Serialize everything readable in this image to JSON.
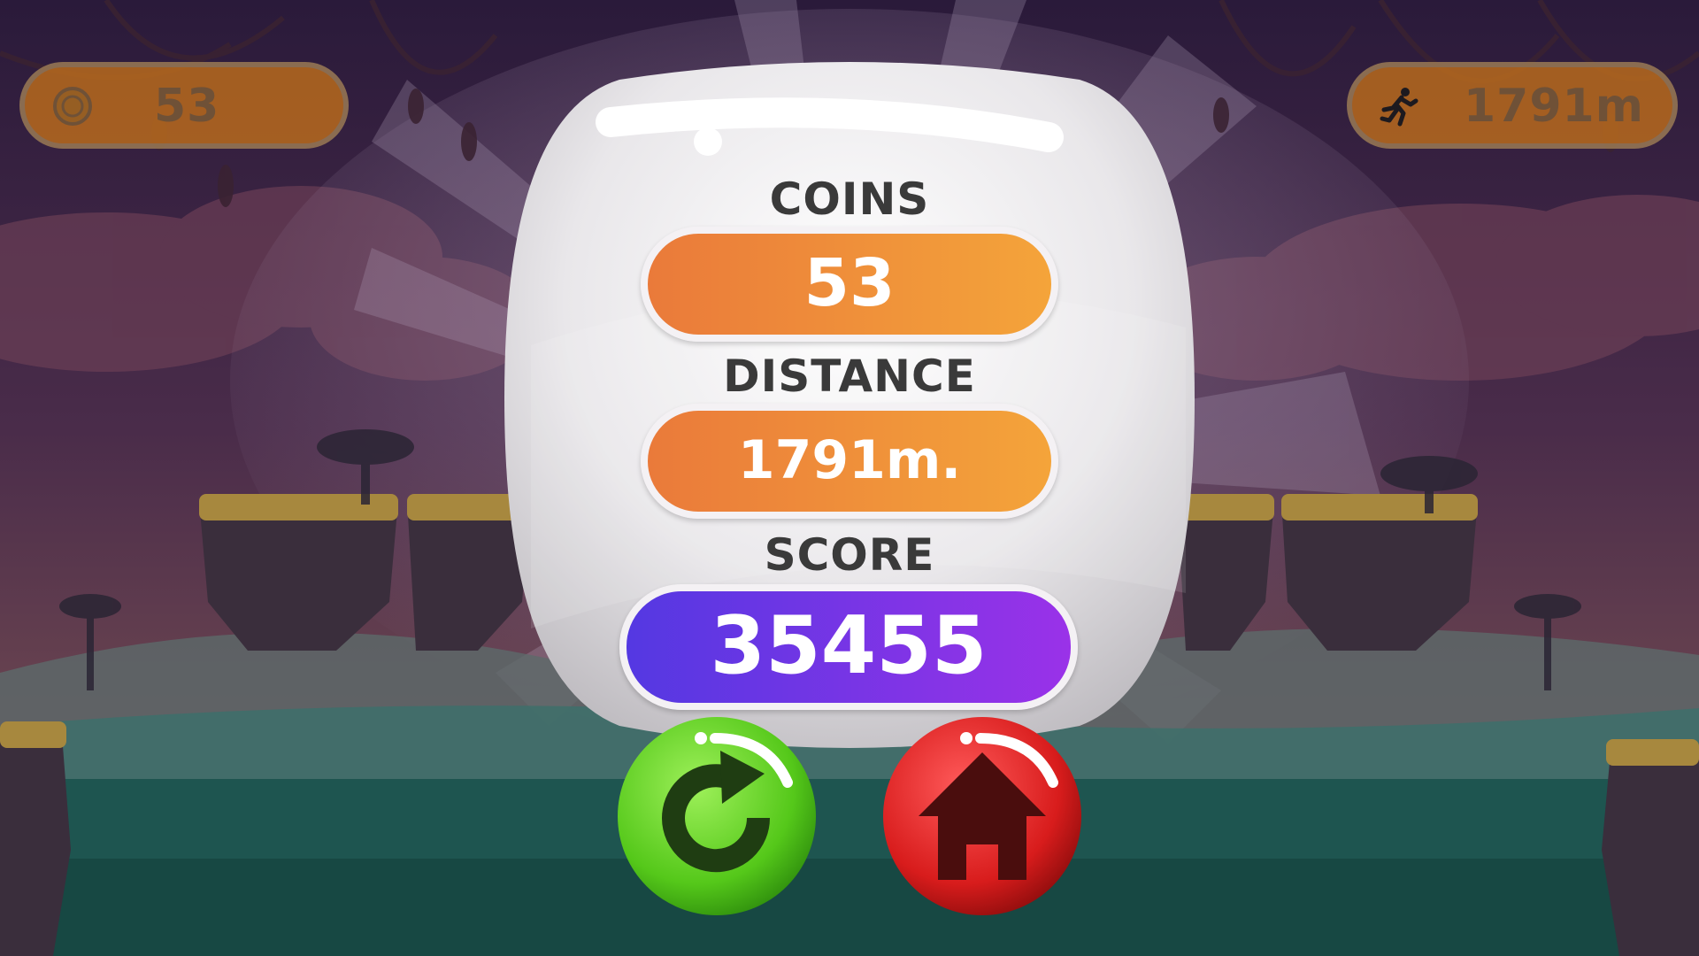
{
  "hud": {
    "coins_value": "53",
    "coin_icon": "coin-icon",
    "distance_value": "1791m",
    "distance_icon": "running-man-icon"
  },
  "results": {
    "coins_label": "COINS",
    "coins_value": "53",
    "distance_label": "DISTANCE",
    "distance_value": "1791m.",
    "score_label": "SCORE",
    "score_value": "35455"
  },
  "buttons": {
    "replay_icon": "replay-icon",
    "home_icon": "home-icon"
  },
  "colors": {
    "coins_pill": "#ef8b3a",
    "distance_pill": "#ef8b3a",
    "score_pill": "#6a35e5",
    "replay_button": "#5ccc1e",
    "home_button": "#d81c1c"
  }
}
